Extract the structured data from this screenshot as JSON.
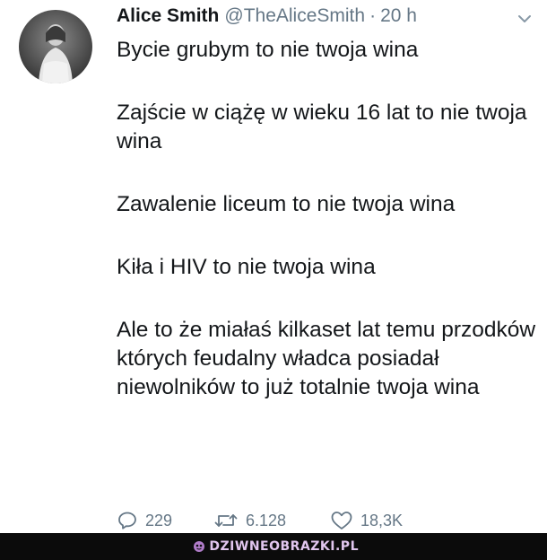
{
  "tweet": {
    "author_name": "Alice Smith",
    "handle": "@TheAliceSmith",
    "separator": "·",
    "time": "20 h",
    "body": [
      "Bycie grubym to nie twoja wina",
      "Zajście w ciążę w wieku 16 lat to nie twoja wina",
      "Zawalenie liceum to nie twoja wina",
      "Kiła i HIV to nie twoja wina",
      "Ale to że miałaś kilkaset lat temu przodków których feudalny władca posiadał niewolników to już totalnie twoja wina"
    ],
    "actions": {
      "replies": "229",
      "retweets": "6.128",
      "likes": "18,3K"
    },
    "icons": {
      "reply": "reply-icon",
      "retweet": "retweet-icon",
      "like": "heart-icon",
      "menu": "chevron-down-icon"
    }
  },
  "footer": {
    "watermark": "DZIWNEOBRAZKI.PL"
  },
  "colors": {
    "text": "#14171a",
    "secondary": "#657786",
    "footer_bg": "#0b0b0b",
    "watermark": "#e1c6ee"
  }
}
